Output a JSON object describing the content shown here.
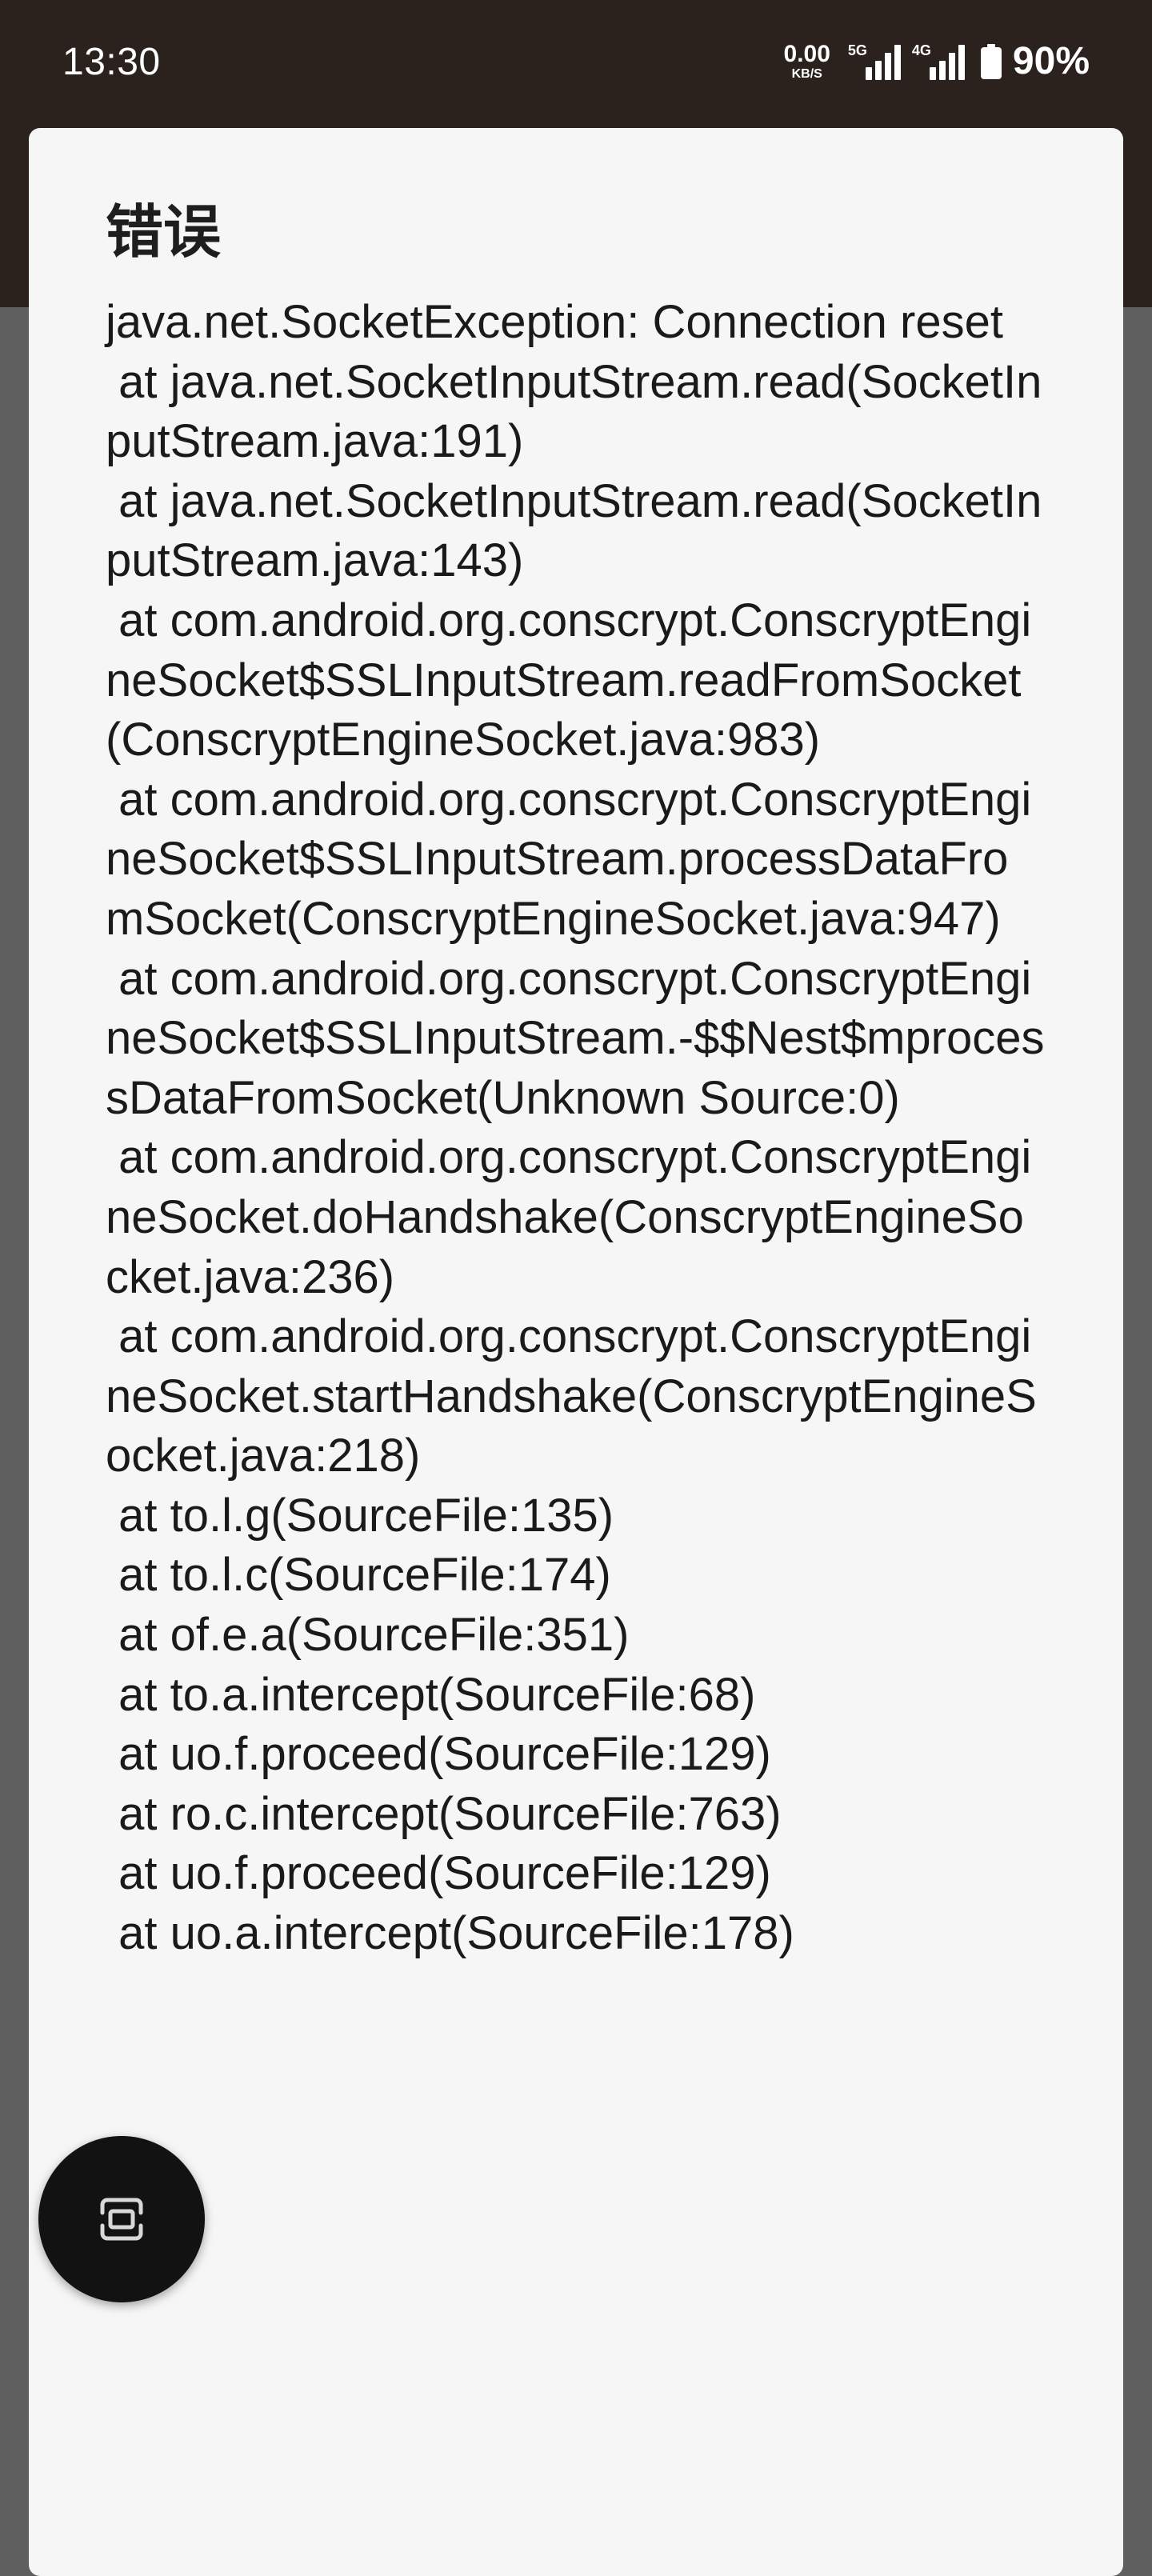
{
  "status_bar": {
    "time": "13:30",
    "net_speed_value": "0.00",
    "net_speed_unit": "KB/S",
    "signal_1_tag": "5G",
    "signal_2_tag": "4G",
    "battery": "90%",
    "battery_level": 0.9
  },
  "dialog": {
    "title": "错误",
    "message": "java.net.SocketException: Connection reset\n at java.net.SocketInputStream.read(SocketInputStream.java:191)\n at java.net.SocketInputStream.read(SocketInputStream.java:143)\n at com.android.org.conscrypt.ConscryptEngineSocket$SSLInputStream.readFromSocket(ConscryptEngineSocket.java:983)\n at com.android.org.conscrypt.ConscryptEngineSocket$SSLInputStream.processDataFromSocket(ConscryptEngineSocket.java:947)\n at com.android.org.conscrypt.ConscryptEngineSocket$SSLInputStream.-$$Nest$mprocessDataFromSocket(Unknown Source:0)\n at com.android.org.conscrypt.ConscryptEngineSocket.doHandshake(ConscryptEngineSocket.java:236)\n at com.android.org.conscrypt.ConscryptEngineSocket.startHandshake(ConscryptEngineSocket.java:218)\n at to.l.g(SourceFile:135)\n at to.l.c(SourceFile:174)\n at of.e.a(SourceFile:351)\n at to.a.intercept(SourceFile:68)\n at uo.f.proceed(SourceFile:129)\n at ro.c.intercept(SourceFile:763)\n at uo.f.proceed(SourceFile:129)\n at uo.a.intercept(SourceFile:178)"
  },
  "fab": {
    "icon": "screen-rotate-icon"
  },
  "colors": {
    "status_bar_bg": "#2c221d",
    "scrim": "#5f5f5f",
    "dialog_bg": "#f6f6f6",
    "fab_bg": "#121212"
  }
}
